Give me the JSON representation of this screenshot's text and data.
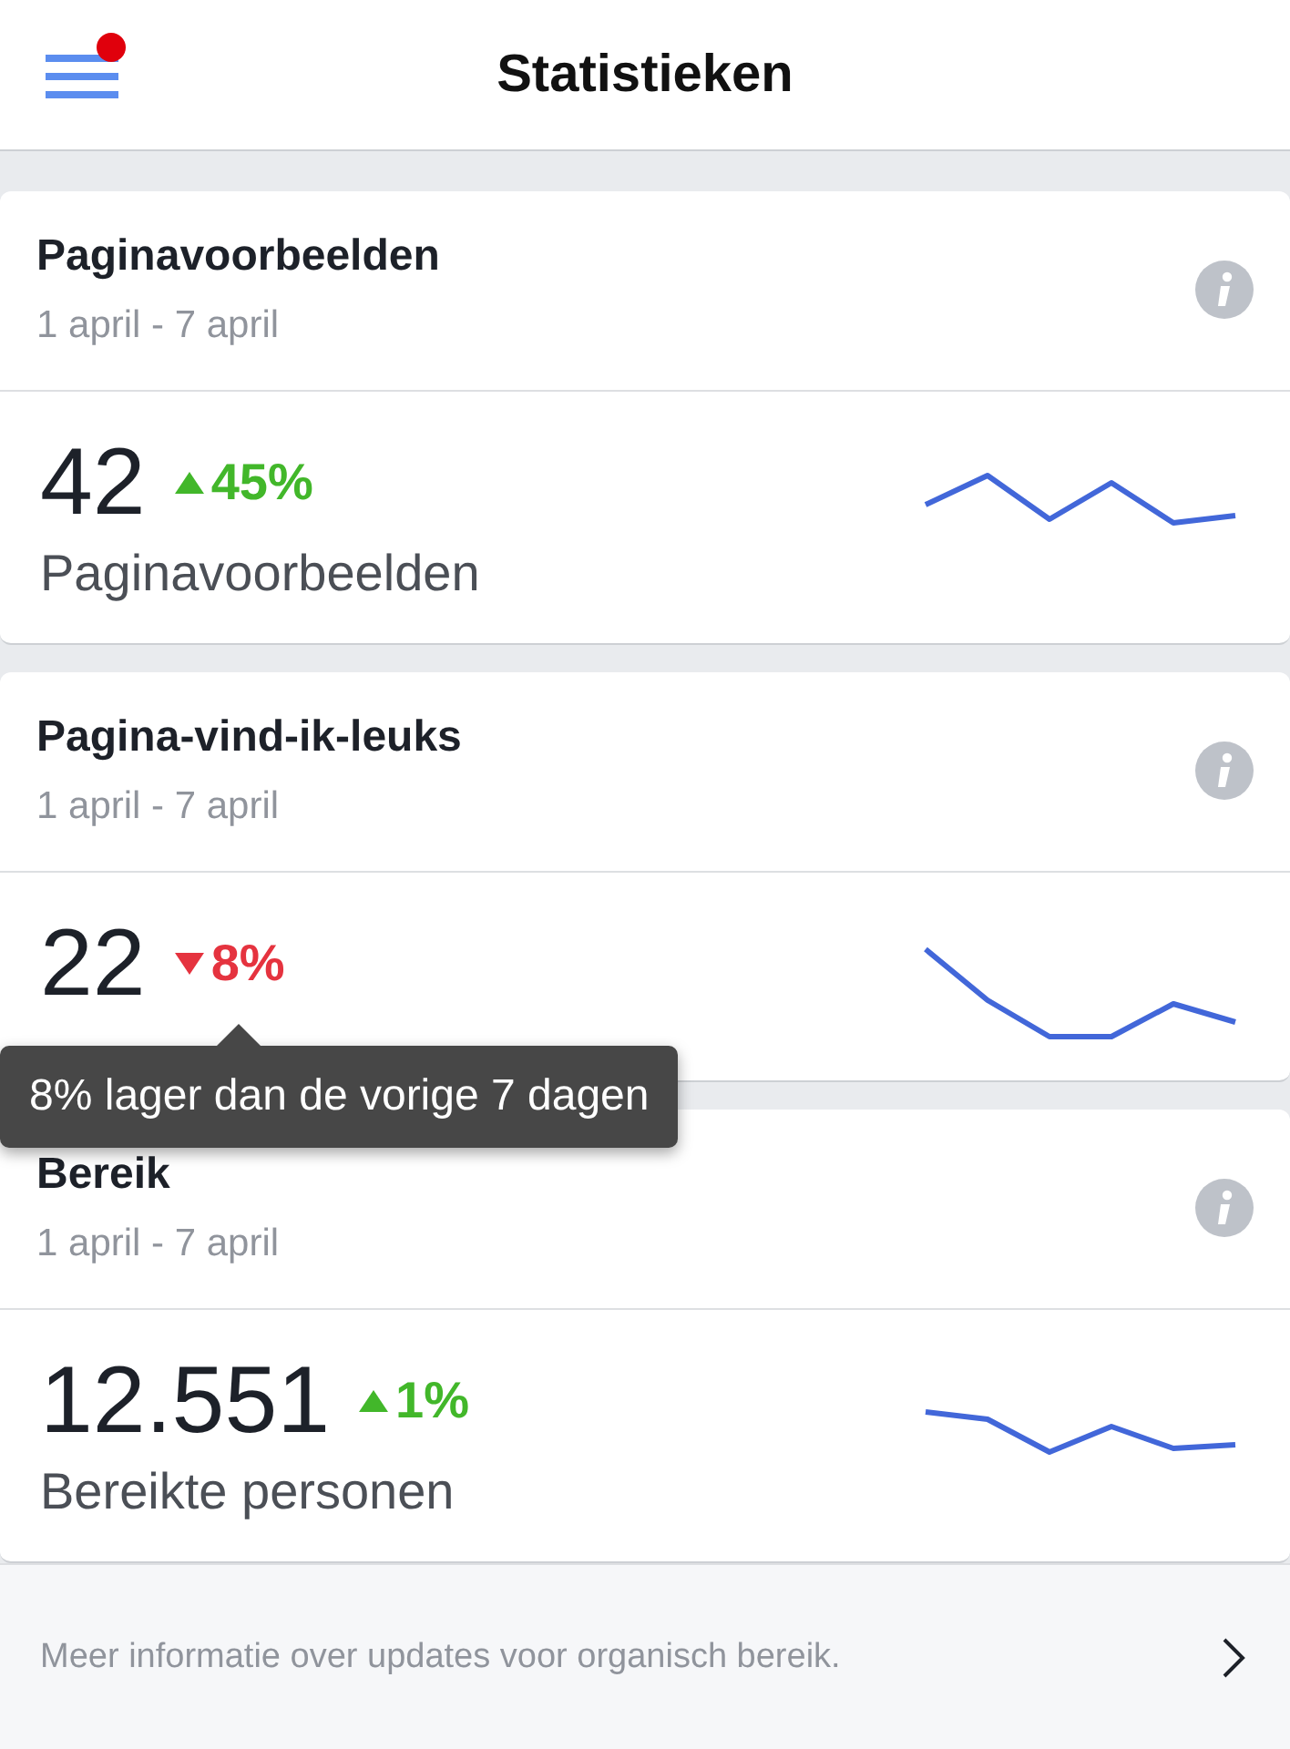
{
  "header": {
    "title": "Statistieken",
    "menu_badge": true
  },
  "cards": [
    {
      "title": "Paginavoorbeelden",
      "range": "1 april - 7 april",
      "value": "42",
      "increase": true,
      "change": "45%",
      "label": "Paginavoorbeelden"
    },
    {
      "title": "Pagina-vind-ik-leuks",
      "range": "1 april - 7 april",
      "value": "22",
      "increase": false,
      "change": "8%",
      "tooltip": "8% lager dan de vorige 7 dagen"
    },
    {
      "title": "Bereik",
      "range": "1 april - 7 april",
      "value": "12.551",
      "increase": true,
      "change": "1%",
      "label": "Bereikte personen"
    }
  ],
  "footer": {
    "text": "Meer informatie over updates voor organisch bereik."
  }
}
